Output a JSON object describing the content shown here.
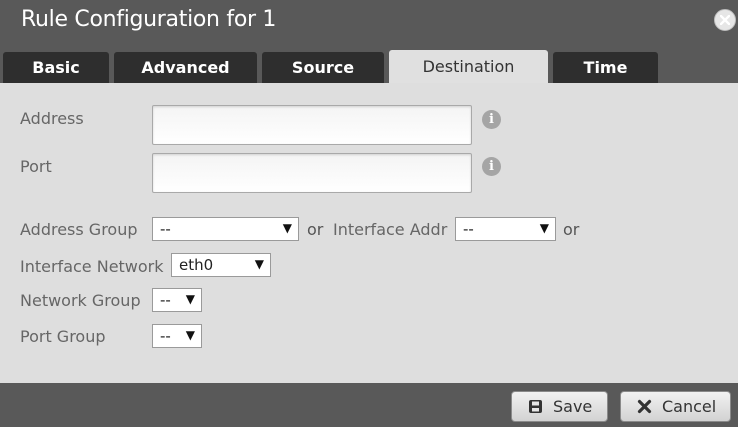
{
  "window": {
    "title": "Rule Configuration for 1",
    "close_icon": "close-icon"
  },
  "tabs": [
    {
      "label": "Basic",
      "active": false
    },
    {
      "label": "Advanced",
      "active": false
    },
    {
      "label": "Source",
      "active": false
    },
    {
      "label": "Destination",
      "active": true
    },
    {
      "label": "Time",
      "active": false
    }
  ],
  "form": {
    "address": {
      "label": "Address",
      "value": "",
      "info_icon": "info-icon"
    },
    "port": {
      "label": "Port",
      "value": "",
      "info_icon": "info-icon"
    },
    "address_group": {
      "label": "Address Group",
      "selected": "--"
    },
    "or_1": "or",
    "interface_addr": {
      "label": "Interface Addr",
      "selected": "--"
    },
    "or_2": "or",
    "interface_network": {
      "label": "Interface Network",
      "selected": "eth0"
    },
    "network_group": {
      "label": "Network Group",
      "selected": "--"
    },
    "port_group": {
      "label": "Port Group",
      "selected": "--"
    },
    "info_glyph": "i",
    "dropdown_arrow": "▼"
  },
  "footer": {
    "save_label": "Save",
    "cancel_label": "Cancel",
    "save_icon": "save-icon",
    "cancel_icon": "cancel-icon"
  },
  "colors": {
    "titlebar": "#595959",
    "panel": "#dedede",
    "tab_inactive": "#2e2e2e",
    "tab_active": "#e0e0e0"
  }
}
